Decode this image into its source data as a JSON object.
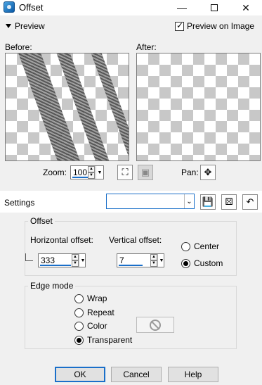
{
  "window": {
    "title": "Offset",
    "minimize": "—",
    "close": "✕"
  },
  "preview": {
    "toggle_label": "Preview",
    "preview_on_image_label": "Preview on Image",
    "preview_on_image_checked": true,
    "before_label": "Before:",
    "after_label": "After:"
  },
  "zoom": {
    "label": "Zoom:",
    "value": "100",
    "pan_label": "Pan:"
  },
  "settings": {
    "label": "Settings",
    "preset_value": ""
  },
  "offset": {
    "title": "Offset",
    "horizontal_label": "Horizontal offset:",
    "horizontal_value": "333",
    "vertical_label": "Vertical offset:",
    "vertical_value": "7",
    "center_label": "Center",
    "custom_label": "Custom",
    "selected": "Custom"
  },
  "edge_mode": {
    "title": "Edge mode",
    "options": [
      "Wrap",
      "Repeat",
      "Color",
      "Transparent"
    ],
    "selected": "Transparent"
  },
  "buttons": {
    "ok": "OK",
    "cancel": "Cancel",
    "help": "Help"
  },
  "colors": {
    "accent": "#1a6fc9",
    "background": "#f0f0f0"
  }
}
